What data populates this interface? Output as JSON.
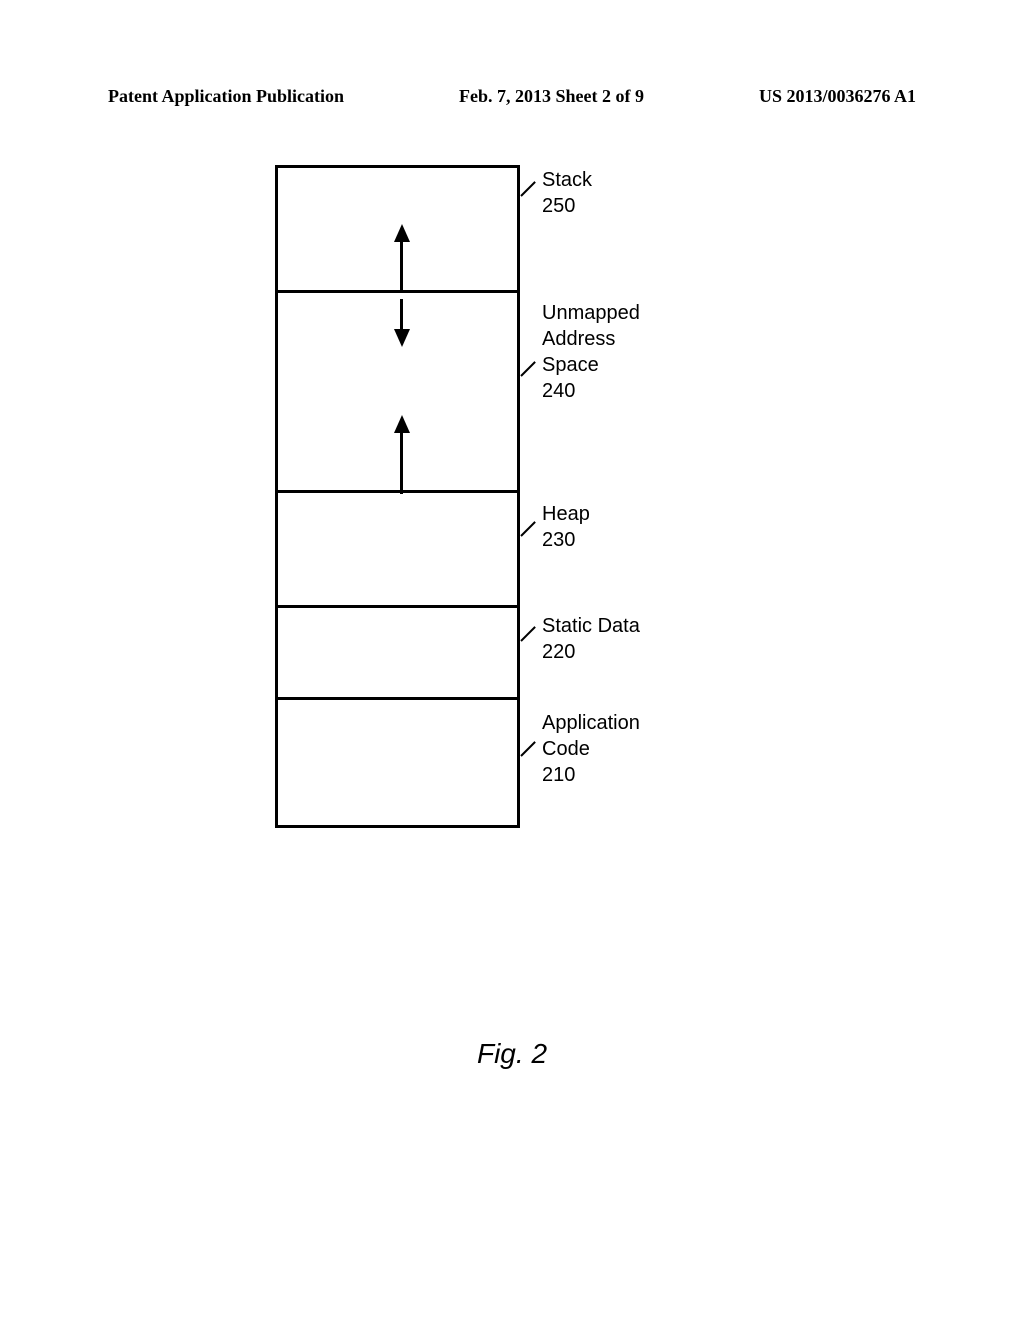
{
  "header": {
    "left": "Patent Application Publication",
    "center": "Feb. 7, 2013  Sheet 2 of 9",
    "right": "US 2013/0036276 A1"
  },
  "diagram": {
    "segments": [
      {
        "label": "Stack",
        "ref": "250"
      },
      {
        "label": "Unmapped\nAddress\nSpace",
        "ref": "240"
      },
      {
        "label": "Heap",
        "ref": "230"
      },
      {
        "label": "Static Data",
        "ref": "220"
      },
      {
        "label": "Application\nCode",
        "ref": "210"
      }
    ]
  },
  "caption": "Fig. 2"
}
